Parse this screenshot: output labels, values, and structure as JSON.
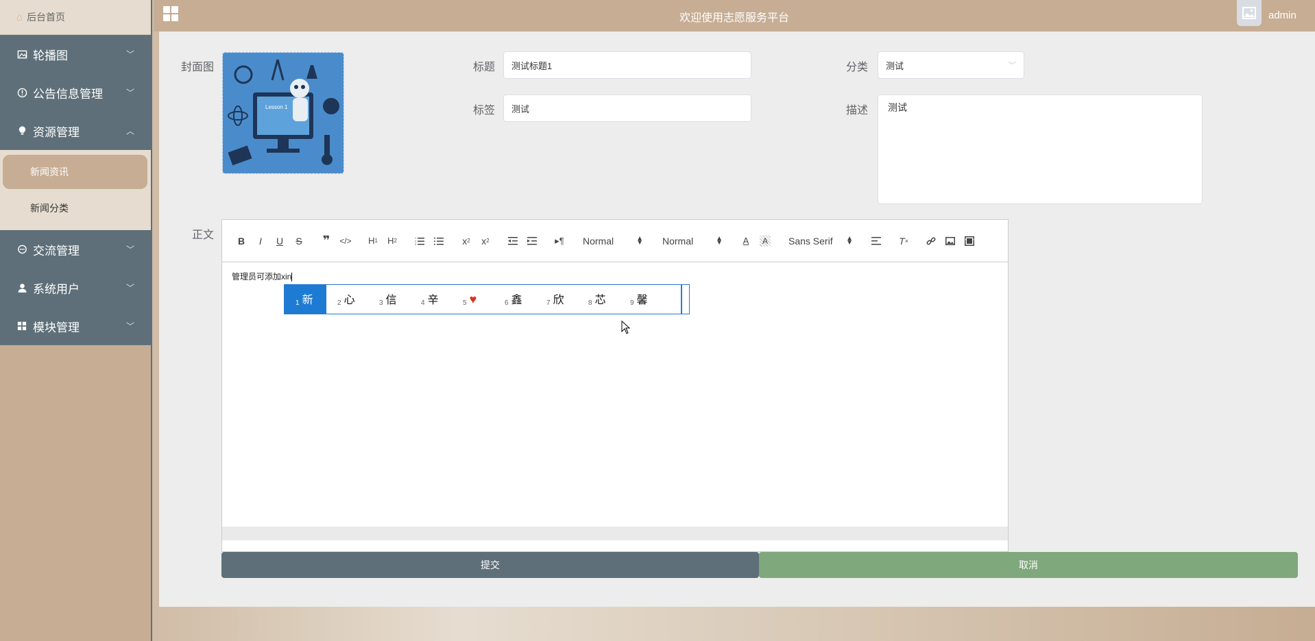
{
  "sidebar": {
    "home": "后台首页",
    "items": [
      {
        "label": "轮播图",
        "icon": "picture-icon",
        "arrow": "chevron-down-icon"
      },
      {
        "label": "公告信息管理",
        "icon": "info-circle-icon",
        "arrow": "chevron-down-icon"
      },
      {
        "label": "资源管理",
        "icon": "lightbulb-icon",
        "arrow": "chevron-up-icon"
      },
      {
        "label": "交流管理",
        "icon": "chat-icon",
        "arrow": "chevron-down-icon"
      },
      {
        "label": "系统用户",
        "icon": "user-icon",
        "arrow": "chevron-down-icon"
      },
      {
        "label": "模块管理",
        "icon": "grid-icon",
        "arrow": "chevron-down-icon"
      }
    ],
    "submenu": [
      "新闻资讯",
      "新闻分类"
    ]
  },
  "header": {
    "title": "欢迎使用志愿服务平台",
    "user": "admin"
  },
  "form": {
    "cover_label": "封面图",
    "title_label": "标题",
    "title_value": "测试标题1",
    "category_label": "分类",
    "category_value": "测试",
    "tag_label": "标签",
    "tag_value": "测试",
    "desc_label": "描述",
    "desc_value": "测试",
    "content_label": "正文"
  },
  "editor": {
    "header_picker": "Normal",
    "size_picker": "Normal",
    "font_picker": "Sans Serif",
    "text": "管理员可添加xin"
  },
  "ime": {
    "candidates": [
      "新",
      "心",
      "信",
      "辛",
      "♥",
      "鑫",
      "欣",
      "芯",
      "馨"
    ]
  },
  "buttons": {
    "submit": "提交",
    "cancel": "取消"
  },
  "colors": {
    "sidebar_menu": "#5e6f79",
    "accent_tan": "#c6ad93",
    "cancel_green": "#7fa87c"
  }
}
